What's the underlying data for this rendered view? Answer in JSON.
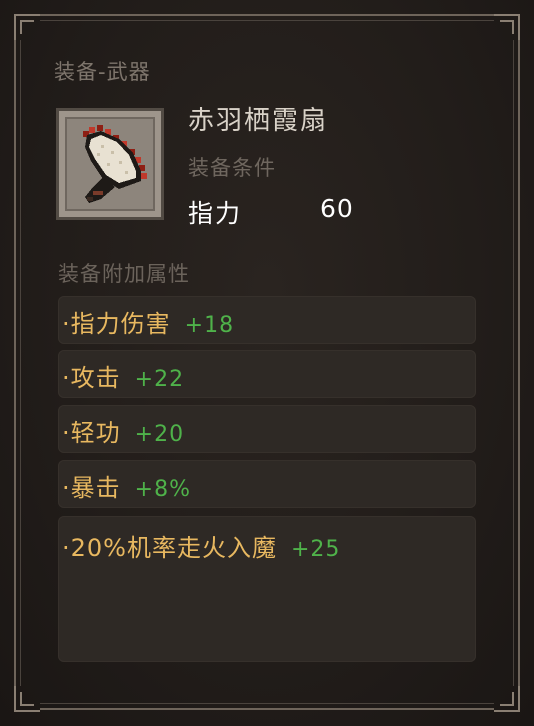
{
  "tooltip": {
    "category_label": "装备-武器",
    "item": {
      "name": "赤羽栖霞扇",
      "icon": "fan-icon",
      "requirement_label": "装备条件",
      "requirement": {
        "stat": "指力",
        "value": "60"
      }
    },
    "attributes_header": "装备附加属性",
    "attributes": [
      {
        "bullet": "·",
        "name": "指力伤害",
        "value": "+18"
      },
      {
        "bullet": "·",
        "name": "攻击",
        "value": "+22"
      },
      {
        "bullet": "·",
        "name": "轻功",
        "value": "+20"
      },
      {
        "bullet": "·",
        "name": "暴击",
        "value": "+8%"
      },
      {
        "bullet": "·",
        "name": "20%机率走火入魔",
        "value": "+25"
      }
    ]
  },
  "colors": {
    "panel_bg": "#221d1a",
    "item_name": "#d9d2c8",
    "attr_name": "#e8b860",
    "attr_value": "#4fb24a",
    "muted_label": "#7e756c"
  }
}
